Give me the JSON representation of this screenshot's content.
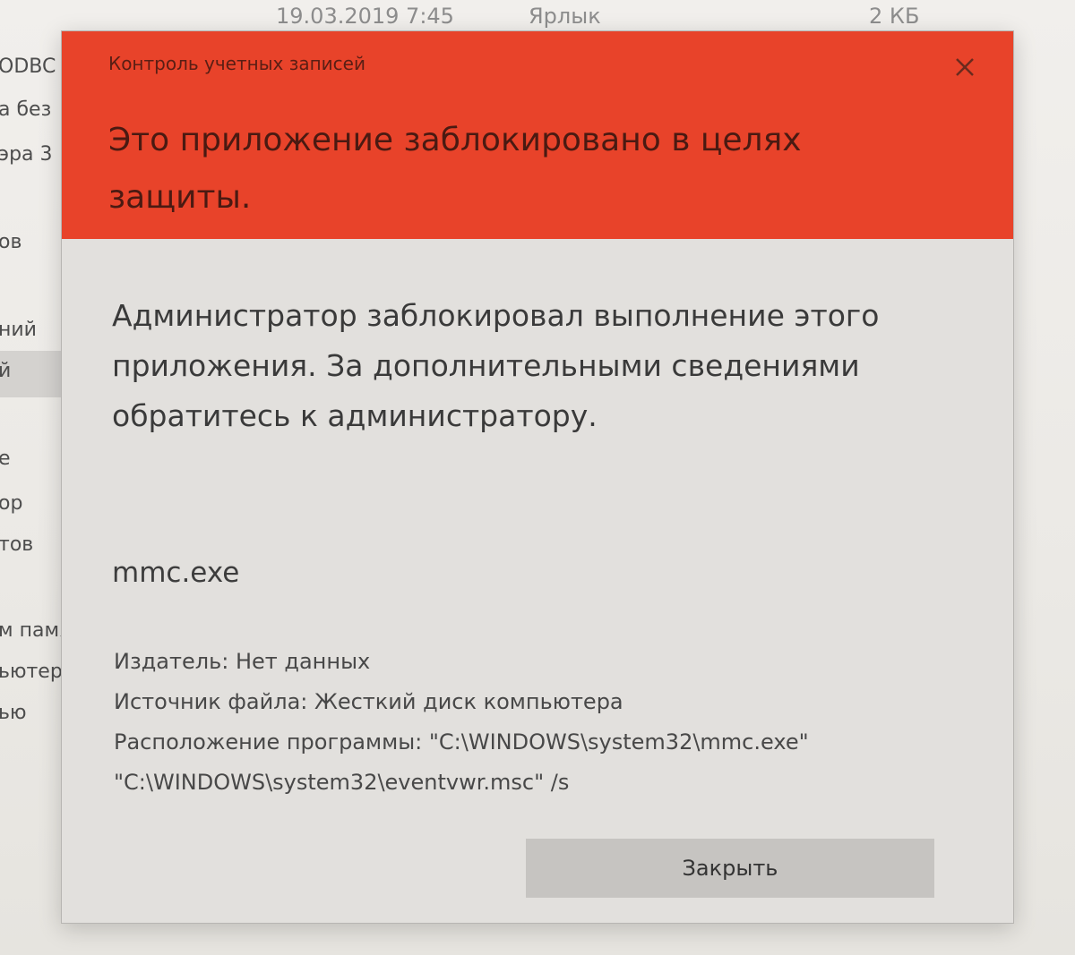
{
  "background": {
    "header": {
      "date": "19.03.2019 7:45",
      "type": "Ярлык",
      "size": "2 КБ"
    },
    "sidebar_items": [
      "ODBC",
      "а без",
      "эра 3",
      "ов",
      "ний",
      "й",
      "е",
      "ор",
      "тов",
      "м памя",
      "ьютере",
      "ью"
    ]
  },
  "dialog": {
    "caption": "Контроль учетных записей",
    "title": "Это приложение заблокировано в целях защиты.",
    "message": "Администратор заблокировал выполнение этого приложения. За дополнительными сведениями обратитесь к администратору.",
    "app_name": "mmc.exe",
    "publisher": "Издатель: Нет данных",
    "file_source": "Источник файла: Жесткий диск компьютера",
    "program_location": "Расположение программы: \"C:\\WINDOWS\\system32\\mmc.exe\" \"C:\\WINDOWS\\system32\\eventvwr.msc\" /s",
    "close_button_label": "Закрыть",
    "close_icon": "close-icon"
  },
  "colors": {
    "header_red": "#e8432a",
    "dialog_background": "#e2e0dd",
    "button_gray": "#c6c4c1"
  }
}
